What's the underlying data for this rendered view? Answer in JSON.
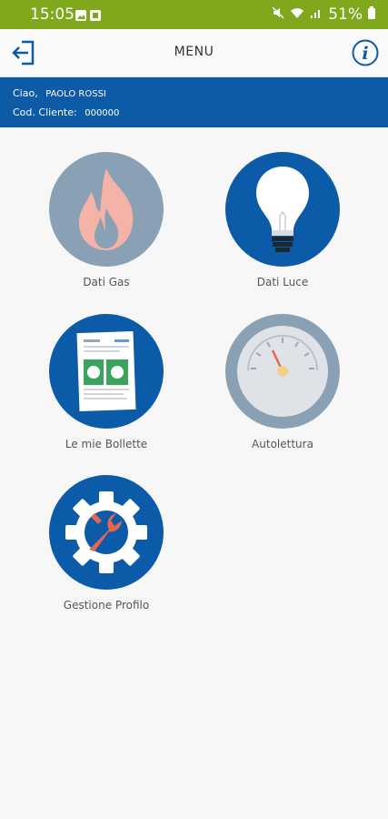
{
  "status_bar": {
    "time": "15:05",
    "battery": "51%"
  },
  "app_bar": {
    "title": "MENU",
    "back_icon": "logout-arrow-icon",
    "info_icon": "info-icon"
  },
  "user": {
    "greeting": "Ciao,",
    "name": "PAOLO ROSSI",
    "customer_code_label": "Cod. Cliente:",
    "customer_code": "000000"
  },
  "menu": {
    "items": [
      {
        "label": "Dati Gas",
        "icon": "flame-icon"
      },
      {
        "label": "Dati Luce",
        "icon": "light-bulb-icon"
      },
      {
        "label": "Le mie Bollette",
        "icon": "bill-document-icon"
      },
      {
        "label": "Autolettura",
        "icon": "meter-gauge-icon"
      },
      {
        "label": "Gestione Profilo",
        "icon": "gear-wrench-icon"
      }
    ]
  },
  "colors": {
    "status_bar": "#7fa81c",
    "brand_blue": "#0d5aa7",
    "tile_gray": "#8aa0b4",
    "flame": "#f4b3a6",
    "wrench": "#e8664f"
  }
}
